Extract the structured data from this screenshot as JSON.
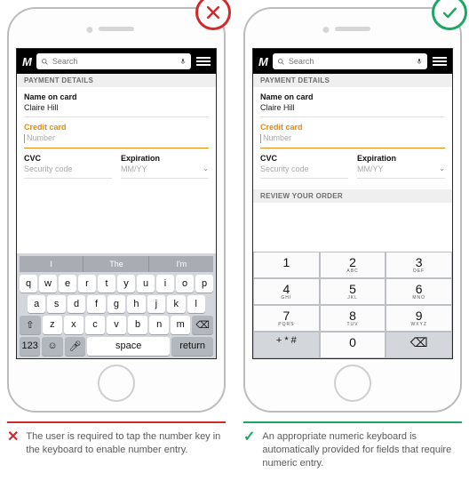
{
  "search_placeholder": "Search",
  "heading": "PAYMENT DETAILS",
  "review_heading": "REVIEW YOUR ORDER",
  "labels": {
    "name": "Name on card",
    "credit": "Credit card",
    "cvc": "CVC",
    "exp": "Expiration"
  },
  "values": {
    "name": "Claire Hill"
  },
  "placeholders": {
    "number": "Number",
    "cvc": "Security code",
    "exp": "MM/YY"
  },
  "qwerty": {
    "suggestions": [
      "I",
      "The",
      "I'm"
    ],
    "row1": [
      "q",
      "w",
      "e",
      "r",
      "t",
      "y",
      "u",
      "i",
      "o",
      "p"
    ],
    "row2": [
      "a",
      "s",
      "d",
      "f",
      "g",
      "h",
      "j",
      "k",
      "l"
    ],
    "row3": [
      "z",
      "x",
      "c",
      "v",
      "b",
      "n",
      "m"
    ],
    "num_key": "123",
    "space": "space",
    "return": "return"
  },
  "numpad": [
    [
      {
        "n": "1",
        "s": ""
      },
      {
        "n": "2",
        "s": "ABC"
      },
      {
        "n": "3",
        "s": "DEF"
      }
    ],
    [
      {
        "n": "4",
        "s": "GHI"
      },
      {
        "n": "5",
        "s": "JKL"
      },
      {
        "n": "6",
        "s": "MNO"
      }
    ],
    [
      {
        "n": "7",
        "s": "PQRS"
      },
      {
        "n": "8",
        "s": "TUV"
      },
      {
        "n": "9",
        "s": "WXYZ"
      }
    ]
  ],
  "numpad_sym": "+ * #",
  "numpad_zero": "0",
  "captions": {
    "bad": "The user is required to tap the number key in the keyboard to enable number entry.",
    "good": "An appropriate numeric keyboard is automatically provided for fields that require numeric entry."
  }
}
